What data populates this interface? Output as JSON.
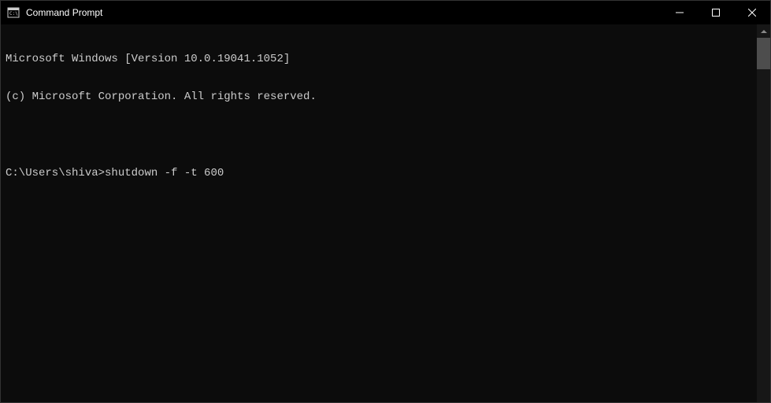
{
  "titlebar": {
    "title": "Command Prompt"
  },
  "terminal": {
    "line1": "Microsoft Windows [Version 10.0.19041.1052]",
    "line2": "(c) Microsoft Corporation. All rights reserved.",
    "prompt": "C:\\Users\\shiva>",
    "command": "shutdown -f -t 600"
  }
}
